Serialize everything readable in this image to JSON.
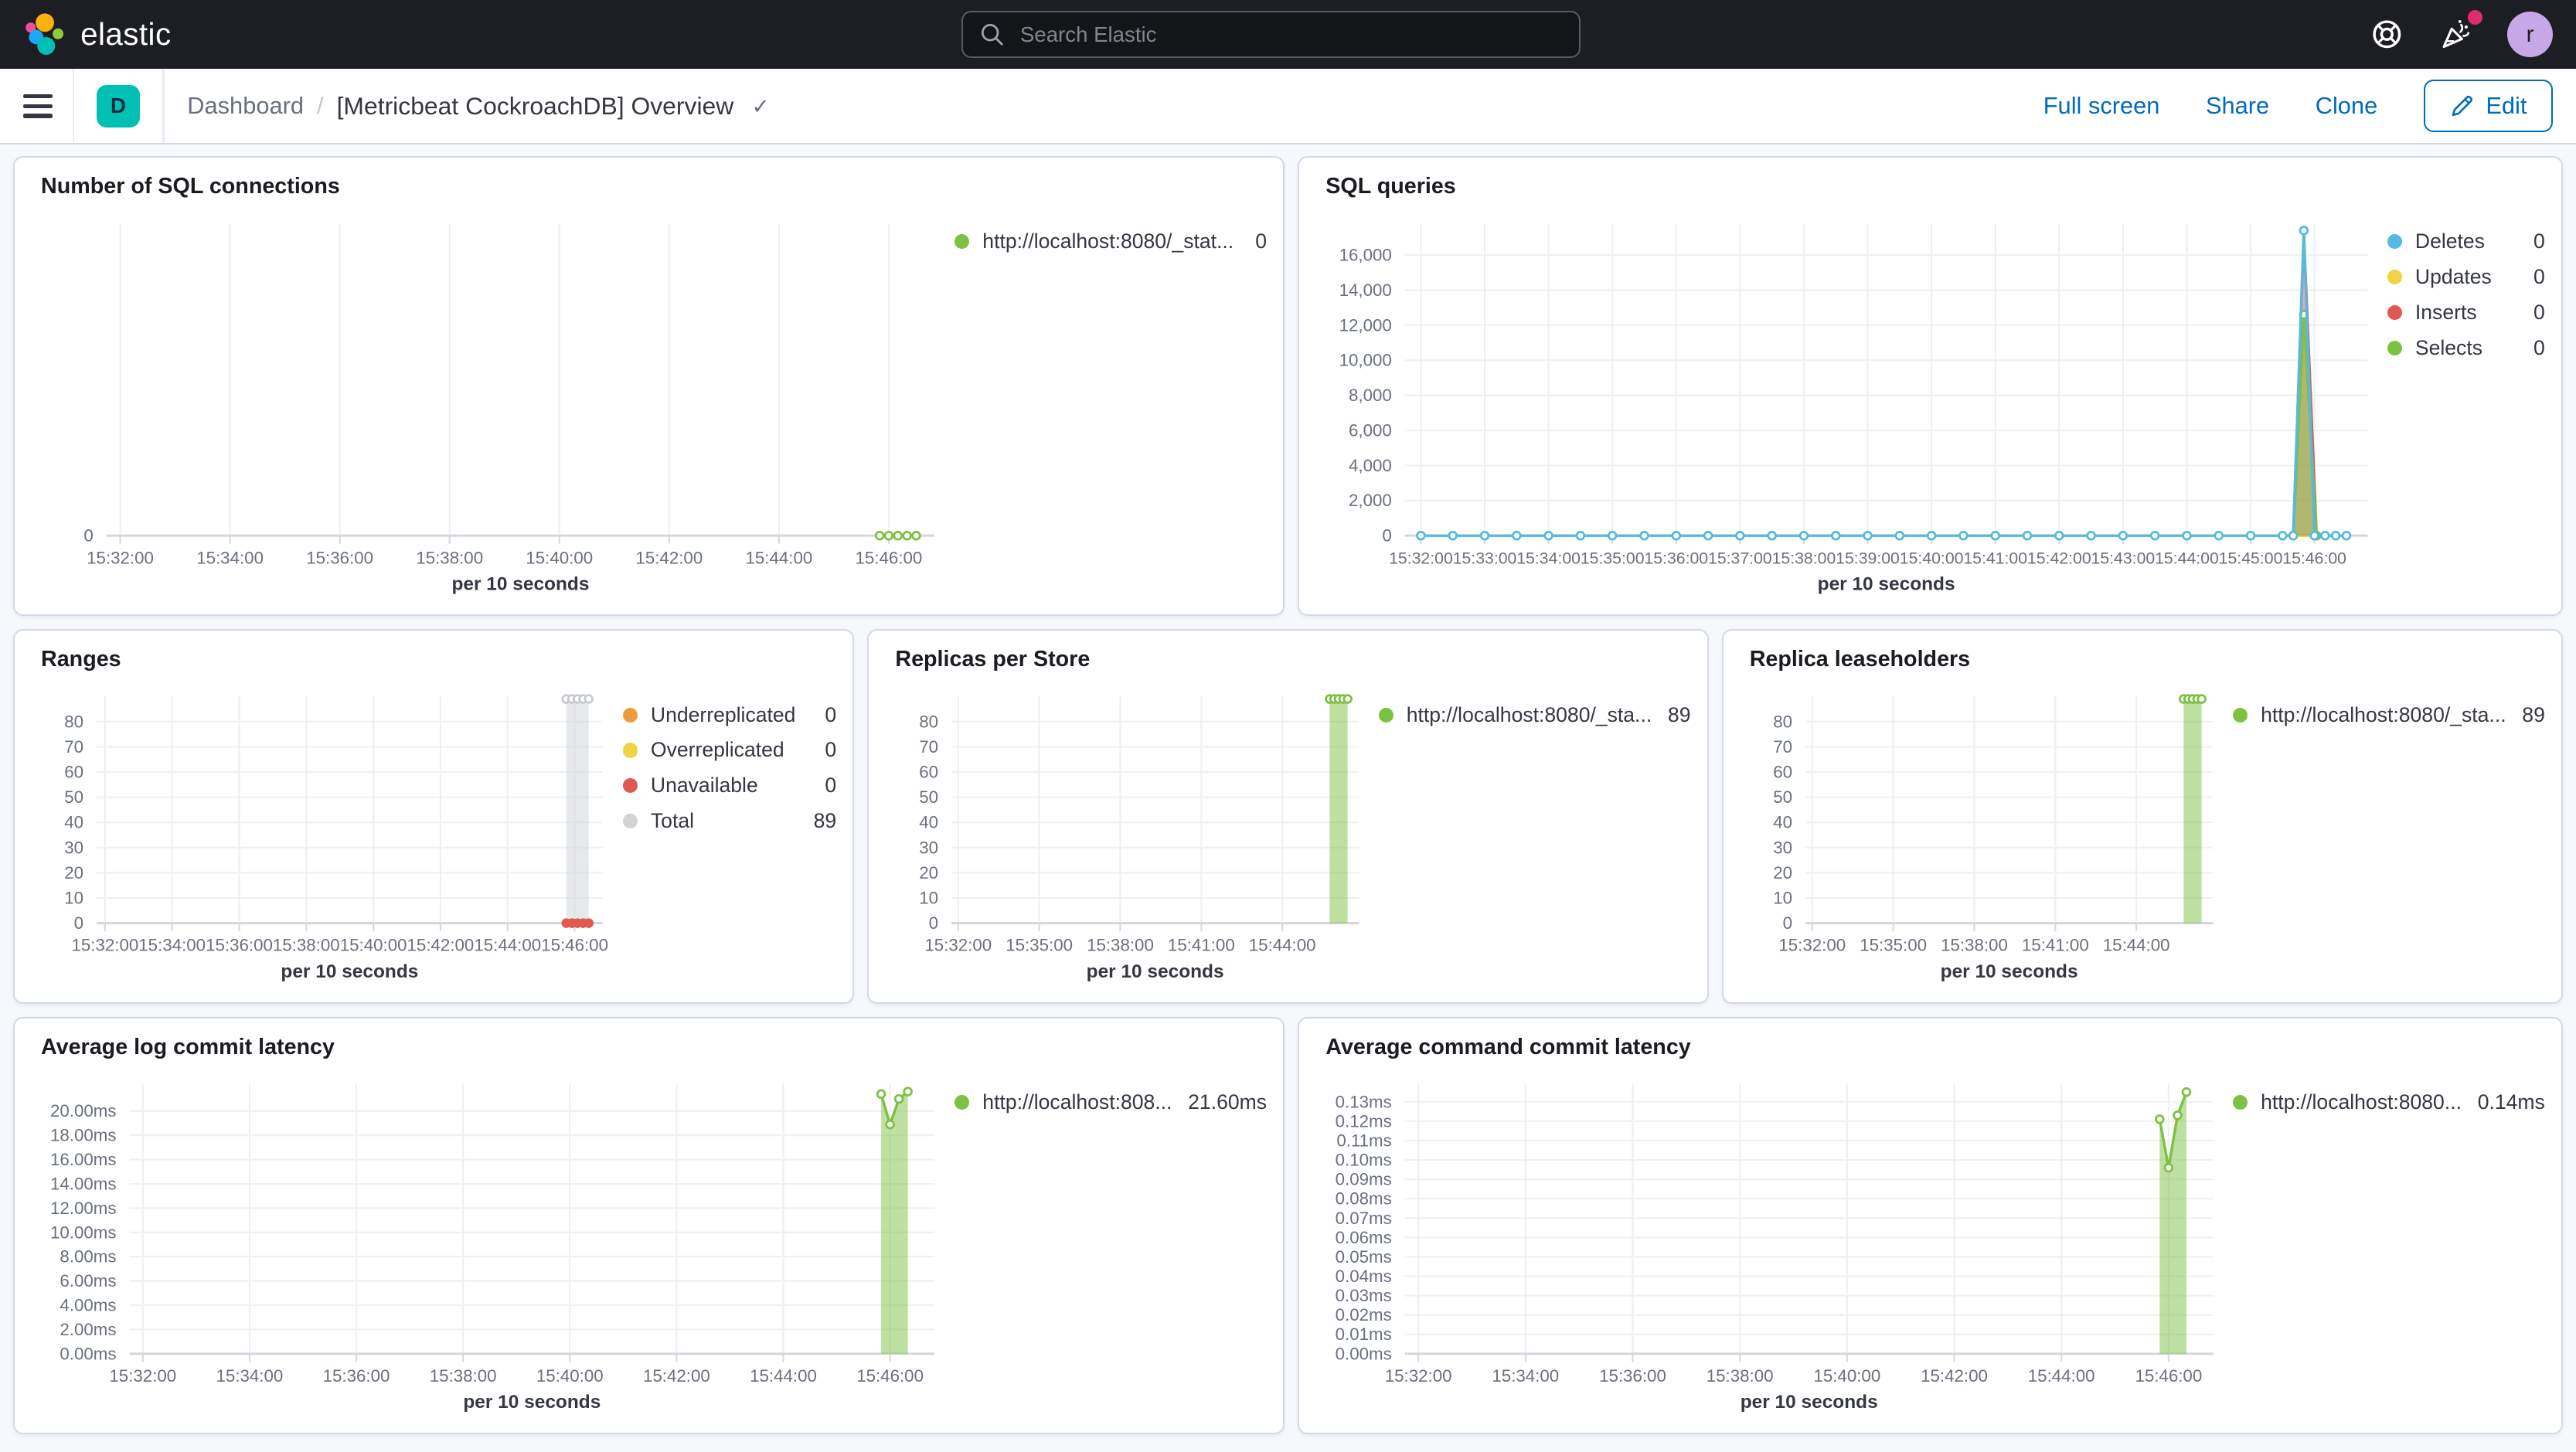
{
  "colors": {
    "primary": "#006bb8",
    "header-bg": "#1d1e24",
    "page-bg": "#f7f8fc",
    "panel-border": "#d3dae6",
    "space-badge": "#00bfb3",
    "avatar-bg": "#c6a8e6",
    "notification": "#dd2e6c"
  },
  "header": {
    "logo_text": "elastic",
    "search_placeholder": "Search Elastic",
    "avatar_initial": "r"
  },
  "toolbar": {
    "space_initial": "D",
    "breadcrumb_root": "Dashboard",
    "breadcrumb_separator": "/",
    "title": "[Metricbeat CockroachDB] Overview",
    "title_check": "✓",
    "full_screen": "Full screen",
    "share": "Share",
    "clone": "Clone",
    "edit": "Edit"
  },
  "panels": [
    {
      "title": "Number of SQL connections",
      "legend": [
        {
          "name": "http://localhost:8080/_stat...",
          "value": "0",
          "color": "#7dc142"
        }
      ]
    },
    {
      "title": "SQL queries",
      "legend": [
        {
          "name": "Deletes",
          "value": "0",
          "color": "#54b9e3"
        },
        {
          "name": "Updates",
          "value": "0",
          "color": "#efd344"
        },
        {
          "name": "Inserts",
          "value": "0",
          "color": "#e0584e"
        },
        {
          "name": "Selects",
          "value": "0",
          "color": "#7dc142"
        }
      ]
    },
    {
      "title": "Ranges",
      "legend": [
        {
          "name": "Underreplicated",
          "value": "0",
          "color": "#ec9b3d"
        },
        {
          "name": "Overreplicated",
          "value": "0",
          "color": "#efd344"
        },
        {
          "name": "Unavailable",
          "value": "0",
          "color": "#e0584e"
        },
        {
          "name": "Total",
          "value": "89",
          "color": "#d3d3d3"
        }
      ]
    },
    {
      "title": "Replicas per Store",
      "legend": [
        {
          "name": "http://localhost:8080/_sta...",
          "value": "89",
          "color": "#7dc142"
        }
      ]
    },
    {
      "title": "Replica leaseholders",
      "legend": [
        {
          "name": "http://localhost:8080/_sta...",
          "value": "89",
          "color": "#7dc142"
        }
      ]
    },
    {
      "title": "Average log commit latency",
      "legend": [
        {
          "name": "http://localhost:808...",
          "value": "21.60ms",
          "color": "#7dc142"
        }
      ]
    },
    {
      "title": "Average command commit latency",
      "legend": [
        {
          "name": "http://localhost:8080...",
          "value": "0.14ms",
          "color": "#7dc142"
        }
      ]
    }
  ],
  "chart_data": [
    {
      "type": "line",
      "title": "Number of SQL connections",
      "xlabel": "per 10 seconds",
      "x_domain": [
        "15:31:45",
        "15:46:50"
      ],
      "margin_left": 46,
      "x_ticks": [
        "15:32:00",
        "15:34:00",
        "15:36:00",
        "15:38:00",
        "15:40:00",
        "15:42:00",
        "15:44:00",
        "15:46:00"
      ],
      "ylim": [
        0,
        10
      ],
      "y_ticks": [
        [
          0,
          "0"
        ]
      ],
      "series": [
        {
          "name": "http://localhost:8080/_stat...",
          "color": "#7dc142",
          "marker": "hollow",
          "points": [
            [
              "15:45:50",
              0
            ],
            [
              "15:46:00",
              0
            ],
            [
              "15:46:10",
              0
            ],
            [
              "15:46:20",
              0
            ],
            [
              "15:46:30",
              0
            ]
          ]
        }
      ]
    },
    {
      "type": "area",
      "title": "SQL queries",
      "xlabel": "per 10 seconds",
      "x_domain": [
        "15:31:45",
        "15:46:50"
      ],
      "margin_left": 54,
      "x_ticks": [
        "15:32:00",
        "15:33:00",
        "15:34:00",
        "15:35:00",
        "15:36:00",
        "15:37:00",
        "15:38:00",
        "15:39:00",
        "15:40:00",
        "15:41:00",
        "15:42:00",
        "15:43:00",
        "15:44:00",
        "15:45:00",
        "15:46:00"
      ],
      "ylim": [
        0,
        17800
      ],
      "y_ticks": [
        [
          0,
          "0"
        ],
        [
          2000,
          "2,000"
        ],
        [
          4000,
          "4,000"
        ],
        [
          6000,
          "6,000"
        ],
        [
          8000,
          "8,000"
        ],
        [
          10000,
          "10,000"
        ],
        [
          12000,
          "12,000"
        ],
        [
          14000,
          "14,000"
        ],
        [
          16000,
          "16,000"
        ]
      ],
      "series": [
        {
          "name": "Updates",
          "color": "#efd344",
          "marker": "none",
          "points": [
            [
              "15:32:00",
              0
            ],
            [
              "15:46:30",
              0
            ]
          ]
        },
        {
          "name": "Inserts",
          "color": "#e0584e",
          "fill": "rgba(224,88,78,0.5)",
          "marker": "none",
          "points": [
            [
              "15:45:40",
              0
            ],
            [
              "15:45:50",
              17200
            ],
            [
              "15:46:02",
              0
            ]
          ]
        },
        {
          "name": "Selects",
          "color": "#7dc142",
          "fill": "rgba(125,193,66,0.55)",
          "marker": "hollow",
          "points": [
            [
              "15:45:40",
              0
            ],
            [
              "15:45:50",
              12600
            ],
            [
              "15:46:02",
              0
            ]
          ]
        },
        {
          "name": "Deletes",
          "color": "#54b9e3",
          "marker": "hollow",
          "points": [
            [
              "15:32:00",
              0
            ],
            [
              "15:32:30",
              0
            ],
            [
              "15:33:00",
              0
            ],
            [
              "15:33:30",
              0
            ],
            [
              "15:34:00",
              0
            ],
            [
              "15:34:30",
              0
            ],
            [
              "15:35:00",
              0
            ],
            [
              "15:35:30",
              0
            ],
            [
              "15:36:00",
              0
            ],
            [
              "15:36:30",
              0
            ],
            [
              "15:37:00",
              0
            ],
            [
              "15:37:30",
              0
            ],
            [
              "15:38:00",
              0
            ],
            [
              "15:38:30",
              0
            ],
            [
              "15:39:00",
              0
            ],
            [
              "15:39:30",
              0
            ],
            [
              "15:40:00",
              0
            ],
            [
              "15:40:30",
              0
            ],
            [
              "15:41:00",
              0
            ],
            [
              "15:41:30",
              0
            ],
            [
              "15:42:00",
              0
            ],
            [
              "15:42:30",
              0
            ],
            [
              "15:43:00",
              0
            ],
            [
              "15:43:30",
              0
            ],
            [
              "15:44:00",
              0
            ],
            [
              "15:44:30",
              0
            ],
            [
              "15:45:00",
              0
            ],
            [
              "15:45:30",
              0
            ],
            [
              "15:45:40",
              0
            ],
            [
              "15:45:50",
              17400
            ],
            [
              "15:46:00",
              0
            ],
            [
              "15:46:10",
              0
            ],
            [
              "15:46:20",
              0
            ],
            [
              "15:46:30",
              0
            ]
          ]
        }
      ]
    },
    {
      "type": "area",
      "title": "Ranges",
      "xlabel": "per 10 seconds",
      "x_domain": [
        "15:31:45",
        "15:46:50"
      ],
      "margin_left": 40,
      "x_ticks": [
        "15:32:00",
        "15:34:00",
        "15:36:00",
        "15:38:00",
        "15:40:00",
        "15:42:00",
        "15:44:00",
        "15:46:00"
      ],
      "ylim": [
        0,
        90
      ],
      "y_ticks": [
        [
          0,
          "0"
        ],
        [
          10,
          "10"
        ],
        [
          20,
          "20"
        ],
        [
          30,
          "30"
        ],
        [
          40,
          "40"
        ],
        [
          50,
          "50"
        ],
        [
          60,
          "60"
        ],
        [
          70,
          "70"
        ],
        [
          80,
          "80"
        ]
      ],
      "series": [
        {
          "name": "Total",
          "color": "#c6c9ce",
          "fill": "rgba(210,213,217,0.55)",
          "marker": "hollow",
          "points": [
            [
              "15:45:45",
              89
            ],
            [
              "15:45:55",
              89
            ],
            [
              "15:46:05",
              89
            ],
            [
              "15:46:15",
              89
            ],
            [
              "15:46:25",
              89
            ]
          ]
        },
        {
          "name": "Unavailable",
          "color": "#e0584e",
          "marker": "solid",
          "points": [
            [
              "15:45:45",
              0
            ],
            [
              "15:45:55",
              0
            ],
            [
              "15:46:05",
              0
            ],
            [
              "15:46:15",
              0
            ],
            [
              "15:46:25",
              0
            ]
          ]
        }
      ]
    },
    {
      "type": "area",
      "title": "Replicas per Store",
      "xlabel": "per 10 seconds",
      "x_domain": [
        "15:31:45",
        "15:46:50"
      ],
      "margin_left": 40,
      "x_ticks": [
        "15:32:00",
        "15:35:00",
        "15:38:00",
        "15:41:00",
        "15:44:00"
      ],
      "ylim": [
        0,
        90
      ],
      "y_ticks": [
        [
          0,
          "0"
        ],
        [
          10,
          "10"
        ],
        [
          20,
          "20"
        ],
        [
          30,
          "30"
        ],
        [
          40,
          "40"
        ],
        [
          50,
          "50"
        ],
        [
          60,
          "60"
        ],
        [
          70,
          "70"
        ],
        [
          80,
          "80"
        ]
      ],
      "series": [
        {
          "name": "http://localhost:8080/_sta...",
          "color": "#7dc142",
          "fill": "rgba(125,193,66,0.5)",
          "marker": "hollow",
          "points": [
            [
              "15:45:45",
              89
            ],
            [
              "15:45:55",
              89
            ],
            [
              "15:46:05",
              89
            ],
            [
              "15:46:15",
              89
            ],
            [
              "15:46:25",
              89
            ]
          ]
        }
      ]
    },
    {
      "type": "area",
      "title": "Replica leaseholders",
      "xlabel": "per 10 seconds",
      "x_domain": [
        "15:31:45",
        "15:46:50"
      ],
      "margin_left": 40,
      "x_ticks": [
        "15:32:00",
        "15:35:00",
        "15:38:00",
        "15:41:00",
        "15:44:00"
      ],
      "ylim": [
        0,
        90
      ],
      "y_ticks": [
        [
          0,
          "0"
        ],
        [
          10,
          "10"
        ],
        [
          20,
          "20"
        ],
        [
          30,
          "30"
        ],
        [
          40,
          "40"
        ],
        [
          50,
          "50"
        ],
        [
          60,
          "60"
        ],
        [
          70,
          "70"
        ],
        [
          80,
          "80"
        ]
      ],
      "series": [
        {
          "name": "http://localhost:8080/_sta...",
          "color": "#7dc142",
          "fill": "rgba(125,193,66,0.5)",
          "marker": "hollow",
          "points": [
            [
              "15:45:45",
              89
            ],
            [
              "15:45:55",
              89
            ],
            [
              "15:46:05",
              89
            ],
            [
              "15:46:15",
              89
            ],
            [
              "15:46:25",
              89
            ]
          ]
        }
      ]
    },
    {
      "type": "area",
      "title": "Average log commit latency",
      "xlabel": "per 10 seconds",
      "x_domain": [
        "15:31:45",
        "15:46:50"
      ],
      "margin_left": 60,
      "x_ticks": [
        "15:32:00",
        "15:34:00",
        "15:36:00",
        "15:38:00",
        "15:40:00",
        "15:42:00",
        "15:44:00",
        "15:46:00"
      ],
      "ylim": [
        0,
        22.2
      ],
      "y_ticks": [
        [
          0,
          "0.00ms"
        ],
        [
          2,
          "2.00ms"
        ],
        [
          4,
          "4.00ms"
        ],
        [
          6,
          "6.00ms"
        ],
        [
          8,
          "8.00ms"
        ],
        [
          10,
          "10.00ms"
        ],
        [
          12,
          "12.00ms"
        ],
        [
          14,
          "14.00ms"
        ],
        [
          16,
          "16.00ms"
        ],
        [
          18,
          "18.00ms"
        ],
        [
          20,
          "20.00ms"
        ]
      ],
      "series": [
        {
          "name": "http://localhost:808...",
          "color": "#7dc142",
          "fill": "rgba(125,193,66,0.5)",
          "marker": "hollow",
          "points": [
            [
              "15:45:50",
              21.4
            ],
            [
              "15:46:00",
              18.9
            ],
            [
              "15:46:10",
              21.0
            ],
            [
              "15:46:20",
              21.6
            ]
          ]
        }
      ]
    },
    {
      "type": "area",
      "title": "Average command commit latency",
      "xlabel": "per 10 seconds",
      "x_domain": [
        "15:31:45",
        "15:46:50"
      ],
      "margin_left": 54,
      "x_ticks": [
        "15:32:00",
        "15:34:00",
        "15:36:00",
        "15:38:00",
        "15:40:00",
        "15:42:00",
        "15:44:00",
        "15:46:00"
      ],
      "ylim": [
        0,
        0.139
      ],
      "y_ticks": [
        [
          0,
          "0.00ms"
        ],
        [
          0.01,
          "0.01ms"
        ],
        [
          0.02,
          "0.02ms"
        ],
        [
          0.03,
          "0.03ms"
        ],
        [
          0.04,
          "0.04ms"
        ],
        [
          0.05,
          "0.05ms"
        ],
        [
          0.06,
          "0.06ms"
        ],
        [
          0.07,
          "0.07ms"
        ],
        [
          0.08,
          "0.08ms"
        ],
        [
          0.09,
          "0.09ms"
        ],
        [
          0.1,
          "0.10ms"
        ],
        [
          0.11,
          "0.11ms"
        ],
        [
          0.12,
          "0.12ms"
        ],
        [
          0.13,
          "0.13ms"
        ]
      ],
      "series": [
        {
          "name": "http://localhost:8080...",
          "color": "#7dc142",
          "fill": "rgba(125,193,66,0.5)",
          "marker": "hollow",
          "points": [
            [
              "15:45:50",
              0.121
            ],
            [
              "15:46:00",
              0.096
            ],
            [
              "15:46:10",
              0.123
            ],
            [
              "15:46:20",
              0.135
            ]
          ]
        }
      ]
    }
  ]
}
